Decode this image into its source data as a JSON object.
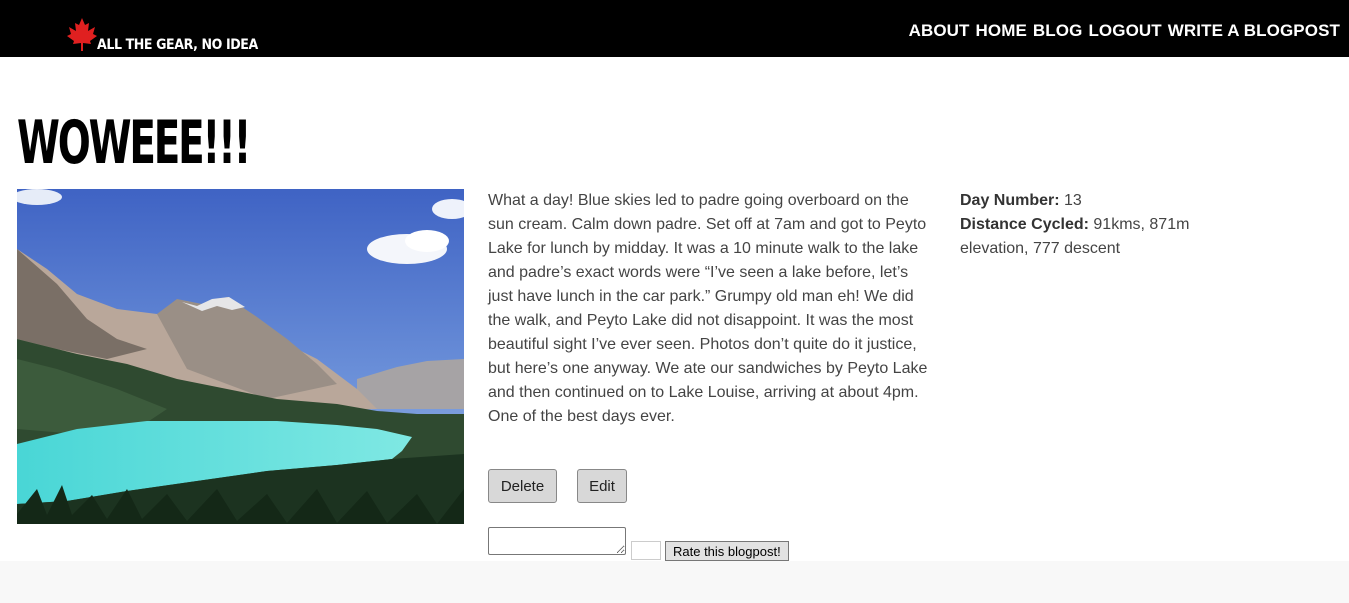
{
  "header": {
    "logo_text": "ALL THE GEAR, NO IDEA",
    "nav": [
      "ABOUT",
      "HOME",
      "BLOG",
      "LOGOUT",
      "WRITE A BLOGPOST"
    ]
  },
  "post": {
    "title": "WOWEEE!!!",
    "body": "What a day! Blue skies led to padre going overboard on the sun cream. Calm down padre. Set off at 7am and got to Peyto Lake for lunch by midday. It was a 10 minute walk to the lake and padre’s exact words were “I’ve seen a lake before, let’s just have lunch in the car park.” Grumpy old man eh! We did the walk, and Peyto Lake did not disappoint. It was the most beautiful sight I’ve ever seen. Photos don’t quite do it justice, but here’s one anyway. We ate our sandwiches by Peyto Lake and then continued on to Lake Louise, arriving at about 4pm. One of the best days ever.",
    "day_label": "Day Number:",
    "day_value": "13",
    "distance_label": "Distance Cycled:",
    "distance_value": "91kms, 871m elevation, 777 descent"
  },
  "actions": {
    "delete_label": "Delete",
    "edit_label": "Edit",
    "rate_label": "Rate this blogpost!"
  },
  "colors": {
    "header_bg": "#000000",
    "leaf_red": "#e02020"
  },
  "icons": {
    "logo": "maple-leaf-icon"
  }
}
